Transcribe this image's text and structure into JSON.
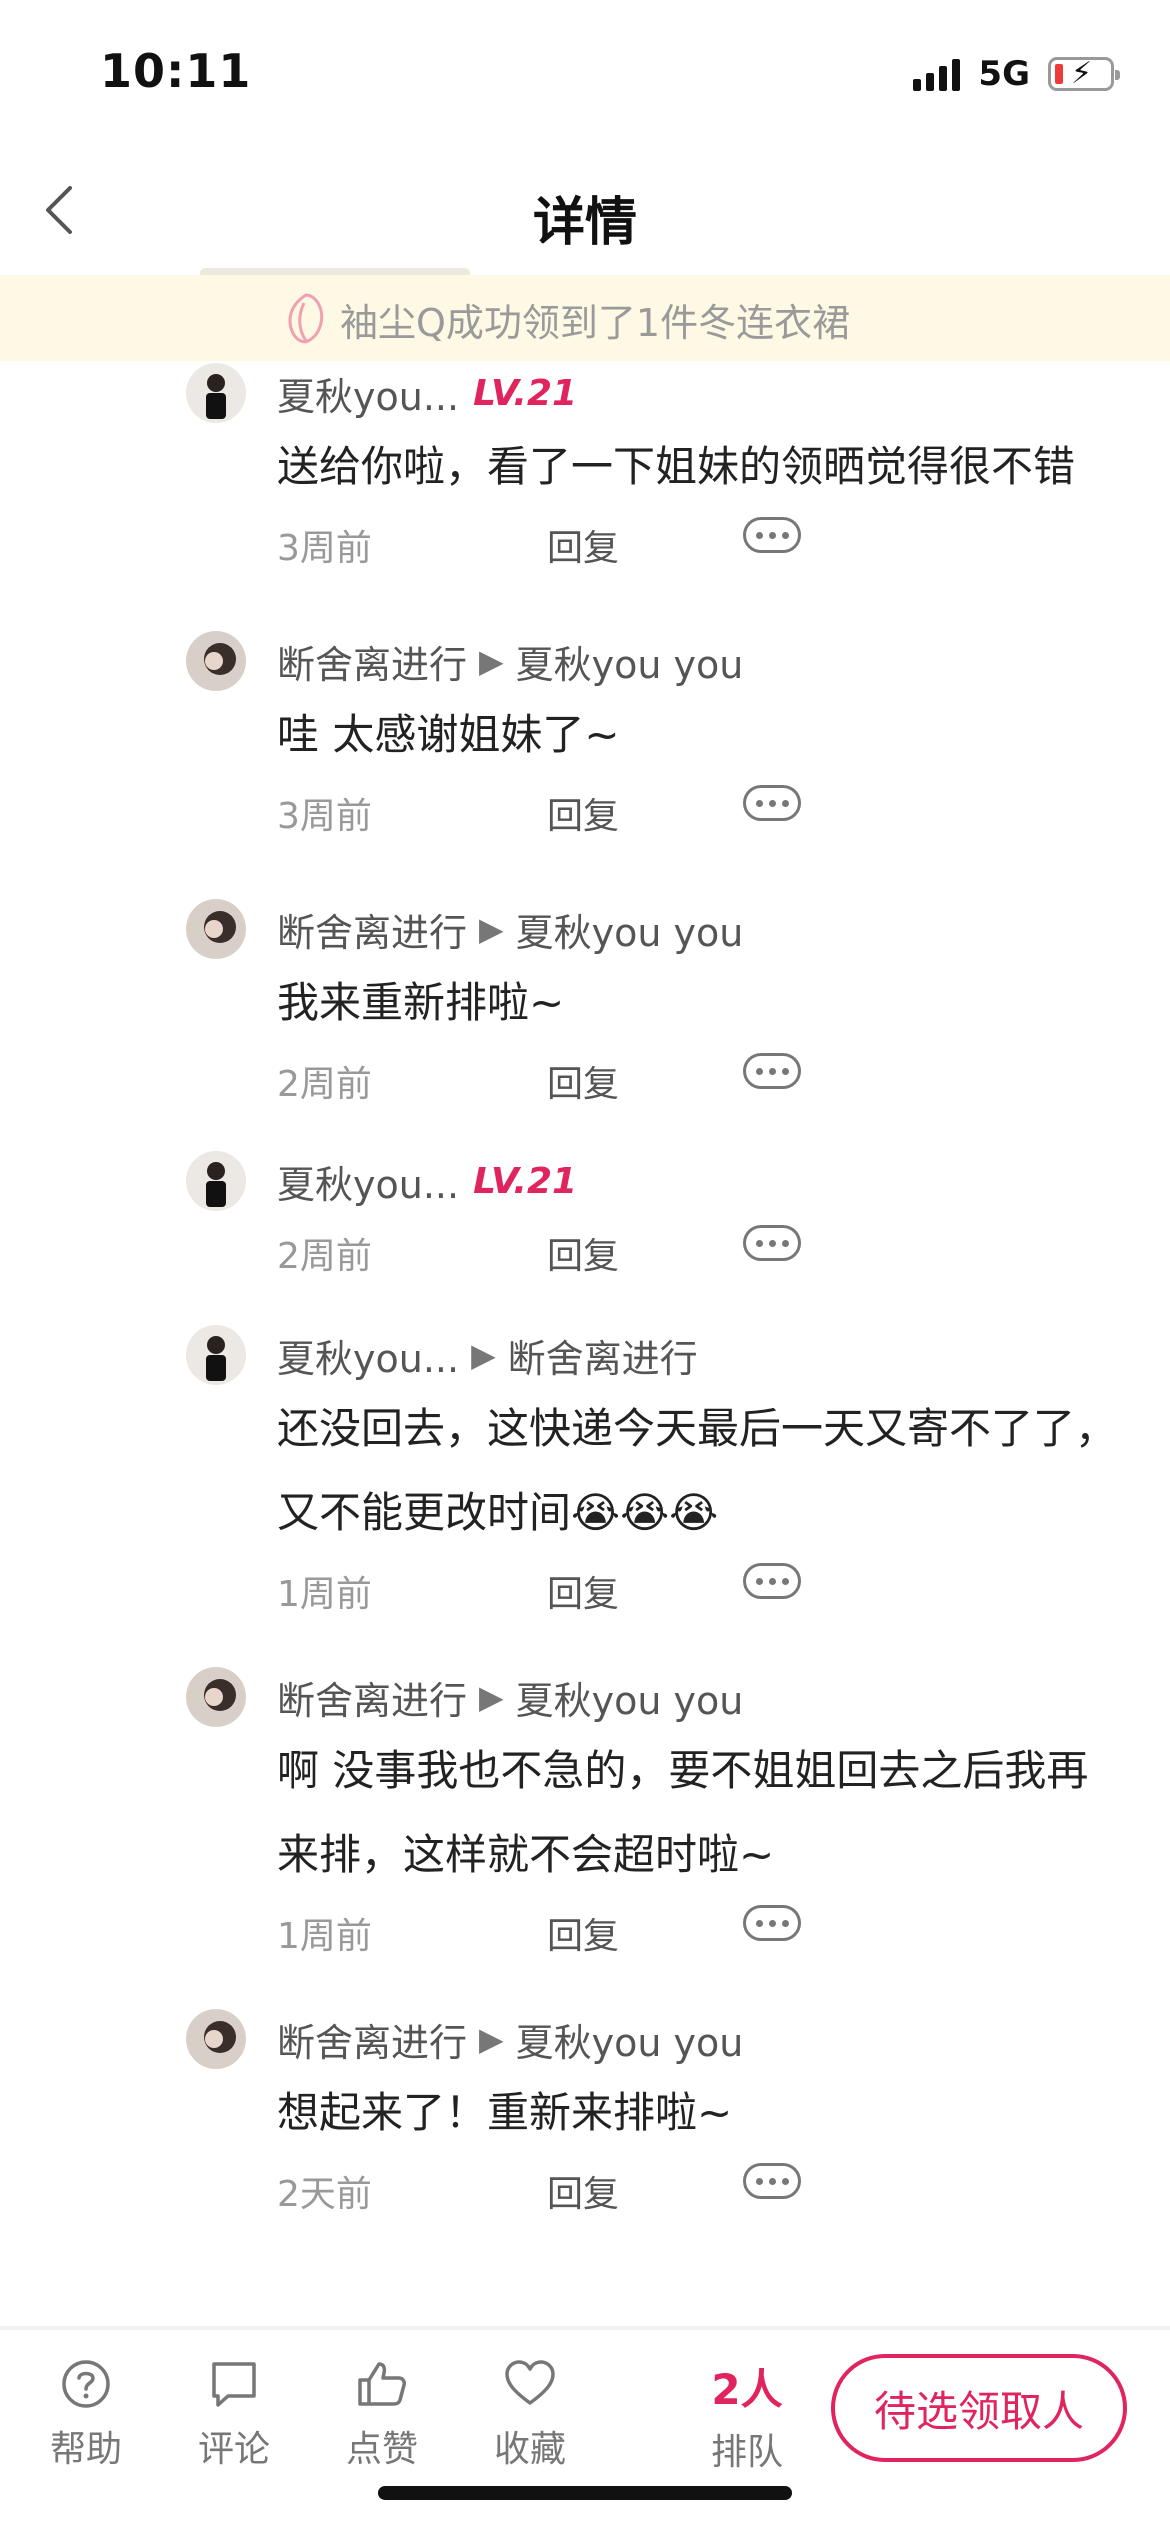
{
  "status_bar": {
    "time": "10:11",
    "network": "5G"
  },
  "nav": {
    "title": "详情"
  },
  "notice": {
    "text": "袖尘Q成功领到了1件冬连衣裙"
  },
  "comments": [
    {
      "author": "夏秋you...",
      "level": "LV.21",
      "reply_to": "",
      "text": "送给你啦，看了一下姐妹的领晒觉得很不错",
      "time": "3周前",
      "reply_label": "回复"
    },
    {
      "author": "断舍离进行",
      "level": "",
      "reply_to": "夏秋you you",
      "text": "哇 太感谢姐妹了~",
      "time": "3周前",
      "reply_label": "回复"
    },
    {
      "author": "断舍离进行",
      "level": "",
      "reply_to": "夏秋you you",
      "text": "我来重新排啦~",
      "time": "2周前",
      "reply_label": "回复"
    },
    {
      "author": "夏秋you...",
      "level": "LV.21",
      "reply_to": "",
      "text": "",
      "time": "2周前",
      "reply_label": "回复"
    },
    {
      "author": "夏秋you...",
      "level": "",
      "reply_to": "断舍离进行",
      "text": "还没回去，这快递今天最后一天又寄不了了，又不能更改时间😭😭😭",
      "time": "1周前",
      "reply_label": "回复"
    },
    {
      "author": "断舍离进行",
      "level": "",
      "reply_to": "夏秋you you",
      "text": "啊 没事我也不急的，要不姐姐回去之后我再来排，这样就不会超时啦~",
      "time": "1周前",
      "reply_label": "回复"
    },
    {
      "author": "断舍离进行",
      "level": "",
      "reply_to": "夏秋you you",
      "text": "想起来了！重新来排啦~",
      "time": "2天前",
      "reply_label": "回复"
    }
  ],
  "bottom_bar": {
    "help": "帮助",
    "comment": "评论",
    "like": "点赞",
    "favorite": "收藏",
    "queue_count": "2人",
    "queue_label": "排队",
    "claim_button": "待选领取人"
  },
  "colors": {
    "accent": "#e0245e",
    "notice_bg": "#fdf9e4"
  }
}
